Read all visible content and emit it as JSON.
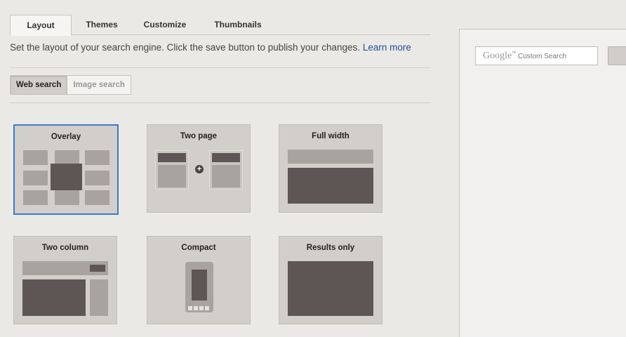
{
  "tabs": [
    "Layout",
    "Themes",
    "Customize",
    "Thumbnails"
  ],
  "description": "Set the layout of your search engine. Click the save button to publish your changes.",
  "learn_more": "Learn more",
  "search_type": {
    "web": "Web search",
    "image": "Image search",
    "selected": "Web search"
  },
  "layouts": [
    "Overlay",
    "Two page",
    "Full width",
    "Two column",
    "Compact",
    "Results only"
  ],
  "selected_layout": "Overlay",
  "preview": {
    "logo": "Google",
    "trademark": "™",
    "placeholder": "Custom Search"
  }
}
